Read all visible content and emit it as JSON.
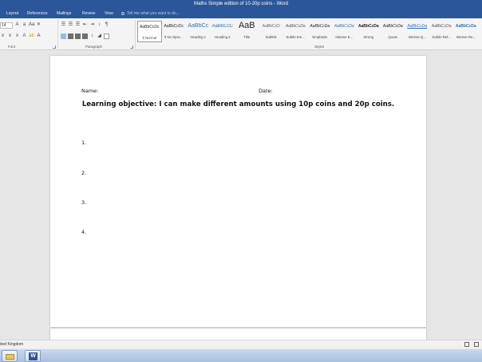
{
  "window": {
    "title": "Maths Simple edition of 10-20p coins - Word"
  },
  "ribbon": {
    "tabs": [
      "Layout",
      "References",
      "Mailings",
      "Review",
      "View"
    ],
    "tell_me": "Tell me what you want to do...",
    "font_size": "14",
    "groups": {
      "font": "Font",
      "paragraph": "Paragraph",
      "styles": "Styles"
    },
    "styles": [
      {
        "sample": "AaBbCcDc",
        "name": "¶ Normal"
      },
      {
        "sample": "AaBbCcDc",
        "name": "¶ No Spac..."
      },
      {
        "sample": "AaBbCc",
        "name": "Heading 1"
      },
      {
        "sample": "AaBbCcC",
        "name": "Heading 2"
      },
      {
        "sample": "AaB",
        "name": "Title"
      },
      {
        "sample": "AaBbCcD",
        "name": "Subtitle"
      },
      {
        "sample": "AaBbCcDa",
        "name": "Subtle Em..."
      },
      {
        "sample": "AaBbCcDa",
        "name": "Emphasis"
      },
      {
        "sample": "AaBbCcDa",
        "name": "Intense E..."
      },
      {
        "sample": "AaBbCcDa",
        "name": "Strong"
      },
      {
        "sample": "AaBbCcDa",
        "name": "Quote"
      },
      {
        "sample": "AaBbCcDa",
        "name": "Intense Q..."
      },
      {
        "sample": "AaBbCcDa",
        "name": "Subtle Ref..."
      },
      {
        "sample": "AaBbCcDa",
        "name": "Intense Re..."
      }
    ]
  },
  "document": {
    "name_label": "Name:",
    "date_label": "Date:",
    "objective": "Learning objective: I can make different amounts using 10p coins and 20p coins.",
    "items": [
      "1.",
      "2.",
      "3.",
      "4."
    ]
  },
  "status": {
    "language": "ited Kingdom"
  },
  "taskbar": {
    "word_label": "W"
  },
  "colors": {
    "accent": "#2b579a",
    "ribbon_bg": "#f4f4f4",
    "canvas_bg": "#e6e6e6"
  }
}
